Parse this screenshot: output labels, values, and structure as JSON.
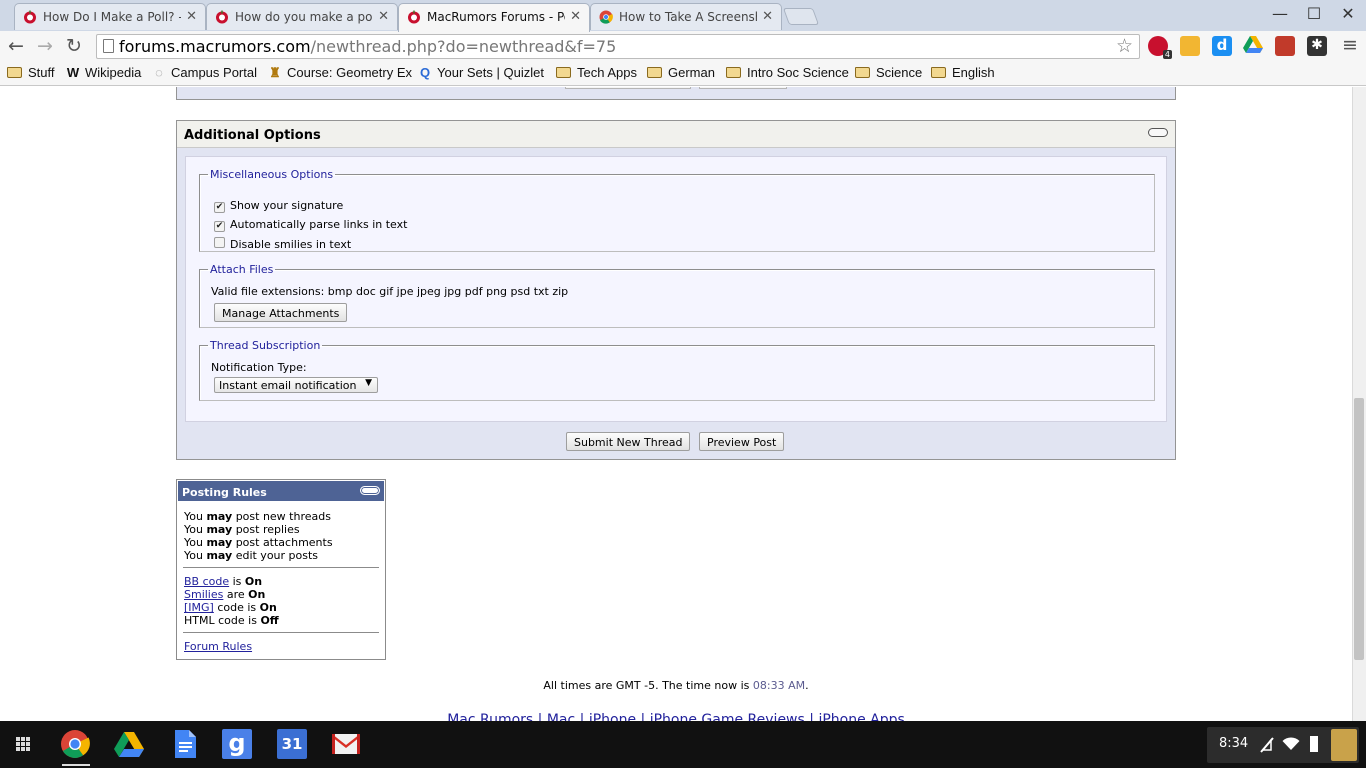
{
  "browser": {
    "tabs": [
      {
        "title": "How Do I Make a Poll? - MacRumors",
        "active": false
      },
      {
        "title": "How do you make a poll?",
        "active": false
      },
      {
        "title": "MacRumors Forums - Post",
        "active": true
      },
      {
        "title": "How to Take A Screenshot",
        "active": false
      }
    ],
    "close_glyph": "✕",
    "window_controls": {
      "minimize": "—",
      "maximize": "☐",
      "close": "✕"
    },
    "nav": {
      "back": "←",
      "forward": "→",
      "reload": "↻",
      "menu": "≡"
    },
    "url_host": "forums.macrumors.com",
    "url_path": "/newthread.php?do=newthread&f=75",
    "star_glyph": "☆",
    "extension_badge": "4",
    "bookmarks": [
      {
        "label": "Stuff",
        "icon": "folder-icon"
      },
      {
        "label": "Wikipedia",
        "icon": "wikipedia-icon",
        "glyph": "W"
      },
      {
        "label": "Campus Portal",
        "icon": "campus-portal-icon",
        "glyph": "◌"
      },
      {
        "label": "Course: Geometry Ex",
        "icon": "course-icon",
        "glyph": "♜"
      },
      {
        "label": "Your Sets | Quizlet",
        "icon": "quizlet-icon",
        "glyph": "Q"
      },
      {
        "label": "Tech Apps",
        "icon": "folder-icon"
      },
      {
        "label": "German",
        "icon": "folder-icon"
      },
      {
        "label": "Intro Soc Science",
        "icon": "folder-icon"
      },
      {
        "label": "Science",
        "icon": "folder-icon"
      },
      {
        "label": "English",
        "icon": "folder-icon"
      }
    ]
  },
  "additional_options": {
    "title": "Additional Options",
    "misc": {
      "legend": "Miscellaneous Options",
      "options": [
        {
          "label": "Show your signature",
          "checked": true
        },
        {
          "label": "Automatically parse links in text",
          "checked": true
        },
        {
          "label": "Disable smilies in text",
          "checked": false
        }
      ]
    },
    "attach": {
      "legend": "Attach Files",
      "extensions_text": "Valid file extensions: bmp doc gif jpe jpeg jpg pdf png psd txt zip",
      "manage_button": "Manage Attachments"
    },
    "subscription": {
      "legend": "Thread Subscription",
      "notification_label": "Notification Type:",
      "notification_value": "Instant email notification",
      "caret": "▼"
    },
    "submit_button": "Submit New Thread",
    "preview_button": "Preview Post"
  },
  "posting_rules": {
    "title": "Posting Rules",
    "permissions": [
      {
        "you": "You",
        "may": "may",
        "rest": "post new threads"
      },
      {
        "you": "You",
        "may": "may",
        "rest": "post replies"
      },
      {
        "you": "You",
        "may": "may",
        "rest": "post attachments"
      },
      {
        "you": "You",
        "may": "may",
        "rest": "edit your posts"
      }
    ],
    "codes": [
      {
        "name": "BB code",
        "link": true,
        "verb": "is",
        "state": "On"
      },
      {
        "name": "Smilies",
        "link": true,
        "verb": "are",
        "state": "On"
      },
      {
        "name": "[IMG]",
        "link": true,
        "verb": "code is",
        "state": "On"
      },
      {
        "name": "HTML code",
        "link": false,
        "verb": "is",
        "state": "Off"
      }
    ],
    "forum_rules_link": "Forum Rules"
  },
  "footer": {
    "time_prefix": "All times are GMT -5. The time now is",
    "time_value": "08:33 AM",
    "time_suffix": ".",
    "links": [
      "Mac Rumors",
      "Mac",
      "iPhone",
      "iPhone Game Reviews",
      "iPhone Apps"
    ],
    "separator": "|"
  },
  "shelf": {
    "clock": "8:34",
    "apps": [
      "apps-launcher-icon",
      "chrome-icon",
      "drive-icon",
      "docs-icon",
      "google-search-icon",
      "calendar-icon",
      "gmail-icon"
    ],
    "calendar_day": "31",
    "google_glyph": "g"
  },
  "colors": {
    "panel_bg": "#e1e4f2",
    "posting_rules_header": "#4e6395",
    "link": "#22229c"
  }
}
